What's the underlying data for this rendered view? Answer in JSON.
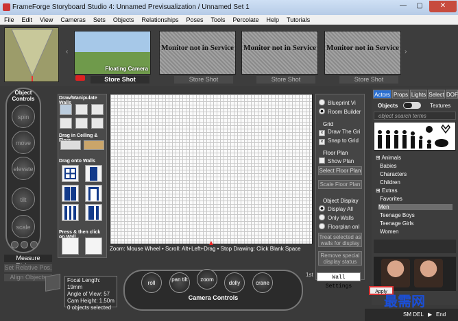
{
  "window": {
    "title": "FrameForge Storyboard Studio 4:  Unnamed Previsualization  /  Unnamed Set 1",
    "minimize": "—",
    "maximize": "▢",
    "close": "✕"
  },
  "menu": [
    "File",
    "Edit",
    "View",
    "Cameras",
    "Sets",
    "Objects",
    "Relationships",
    "Poses",
    "Tools",
    "Percolate",
    "Help",
    "Tutorials"
  ],
  "cameras": {
    "nav_left": "‹",
    "nav_right": "›",
    "floating_label": "Floating Camera",
    "monitor_text": "Monitor not in Service",
    "store_shot": "Store Shot"
  },
  "object_controls": {
    "title": "Object Controls",
    "buttons": [
      "spin",
      "move",
      "elevate",
      "tilt",
      "scale"
    ],
    "measure_distance": "Measure Distance",
    "set_relative_pos": "Set Relative Pos.",
    "align_objects": "Align Objects"
  },
  "tools": {
    "draw_walls": "Draw/Manipulate Walls",
    "drag_ceiling": "Drag in Ceiling & Floor",
    "drag_walls": "Drag onto Walls",
    "press_click": "Press & then click on Wall"
  },
  "grid": {
    "hint": "Zoom: Mouse Wheel • Scroll: Alt+Left+Drag • Stop Drawing: Click Blank Space"
  },
  "options": {
    "blueprint": "Blueprint Vi",
    "room_builder": "Room Builder",
    "grid_header": "Grid",
    "draw_grid": "Draw The Gri",
    "snap_grid": "Snap to Grid",
    "floor_plan_header": "Floor Plan",
    "show_plan": "Show Plan",
    "select_floor_plan": "Select Floor Plan",
    "scale_floor_plan": "Scale Floor Plan",
    "object_display_header": "Object Display",
    "display_all": "Display All",
    "only_walls": "Only Walls",
    "floorplan_only": "Floorplan onl",
    "treat_walls": "Treat selected as walls for display",
    "remove_status": "Remove special display status",
    "wall_settings": "Wall Settings",
    "first": "1st"
  },
  "library": {
    "tabs": [
      "Actors",
      "Props",
      "Lights",
      "Select",
      "DOF"
    ],
    "objects_label": "Objects",
    "textures_label": "Textures",
    "search_placeholder": "object search terms",
    "tree": [
      "Animals",
      "Babies",
      "Characters",
      "Children",
      "Extras",
      "Favorites",
      "Men",
      "Teenage Boys",
      "Teenage Girls",
      "Women"
    ],
    "selected": "Men",
    "apply": "Apply"
  },
  "camera_controls": {
    "title": "Camera Controls",
    "buttons": [
      "roll",
      "pan tilt",
      "zoom",
      "dolly",
      "crane"
    ]
  },
  "info": {
    "focal_length": "Focal Length: 19mm",
    "angle_of_view": "Angle of View: 57",
    "cam_height": "Cam Height: 1.50m",
    "objects_selected": "0 objects selected"
  },
  "status": {
    "sm_del": "SM DEL",
    "end": "End"
  },
  "watermark": "最需网"
}
